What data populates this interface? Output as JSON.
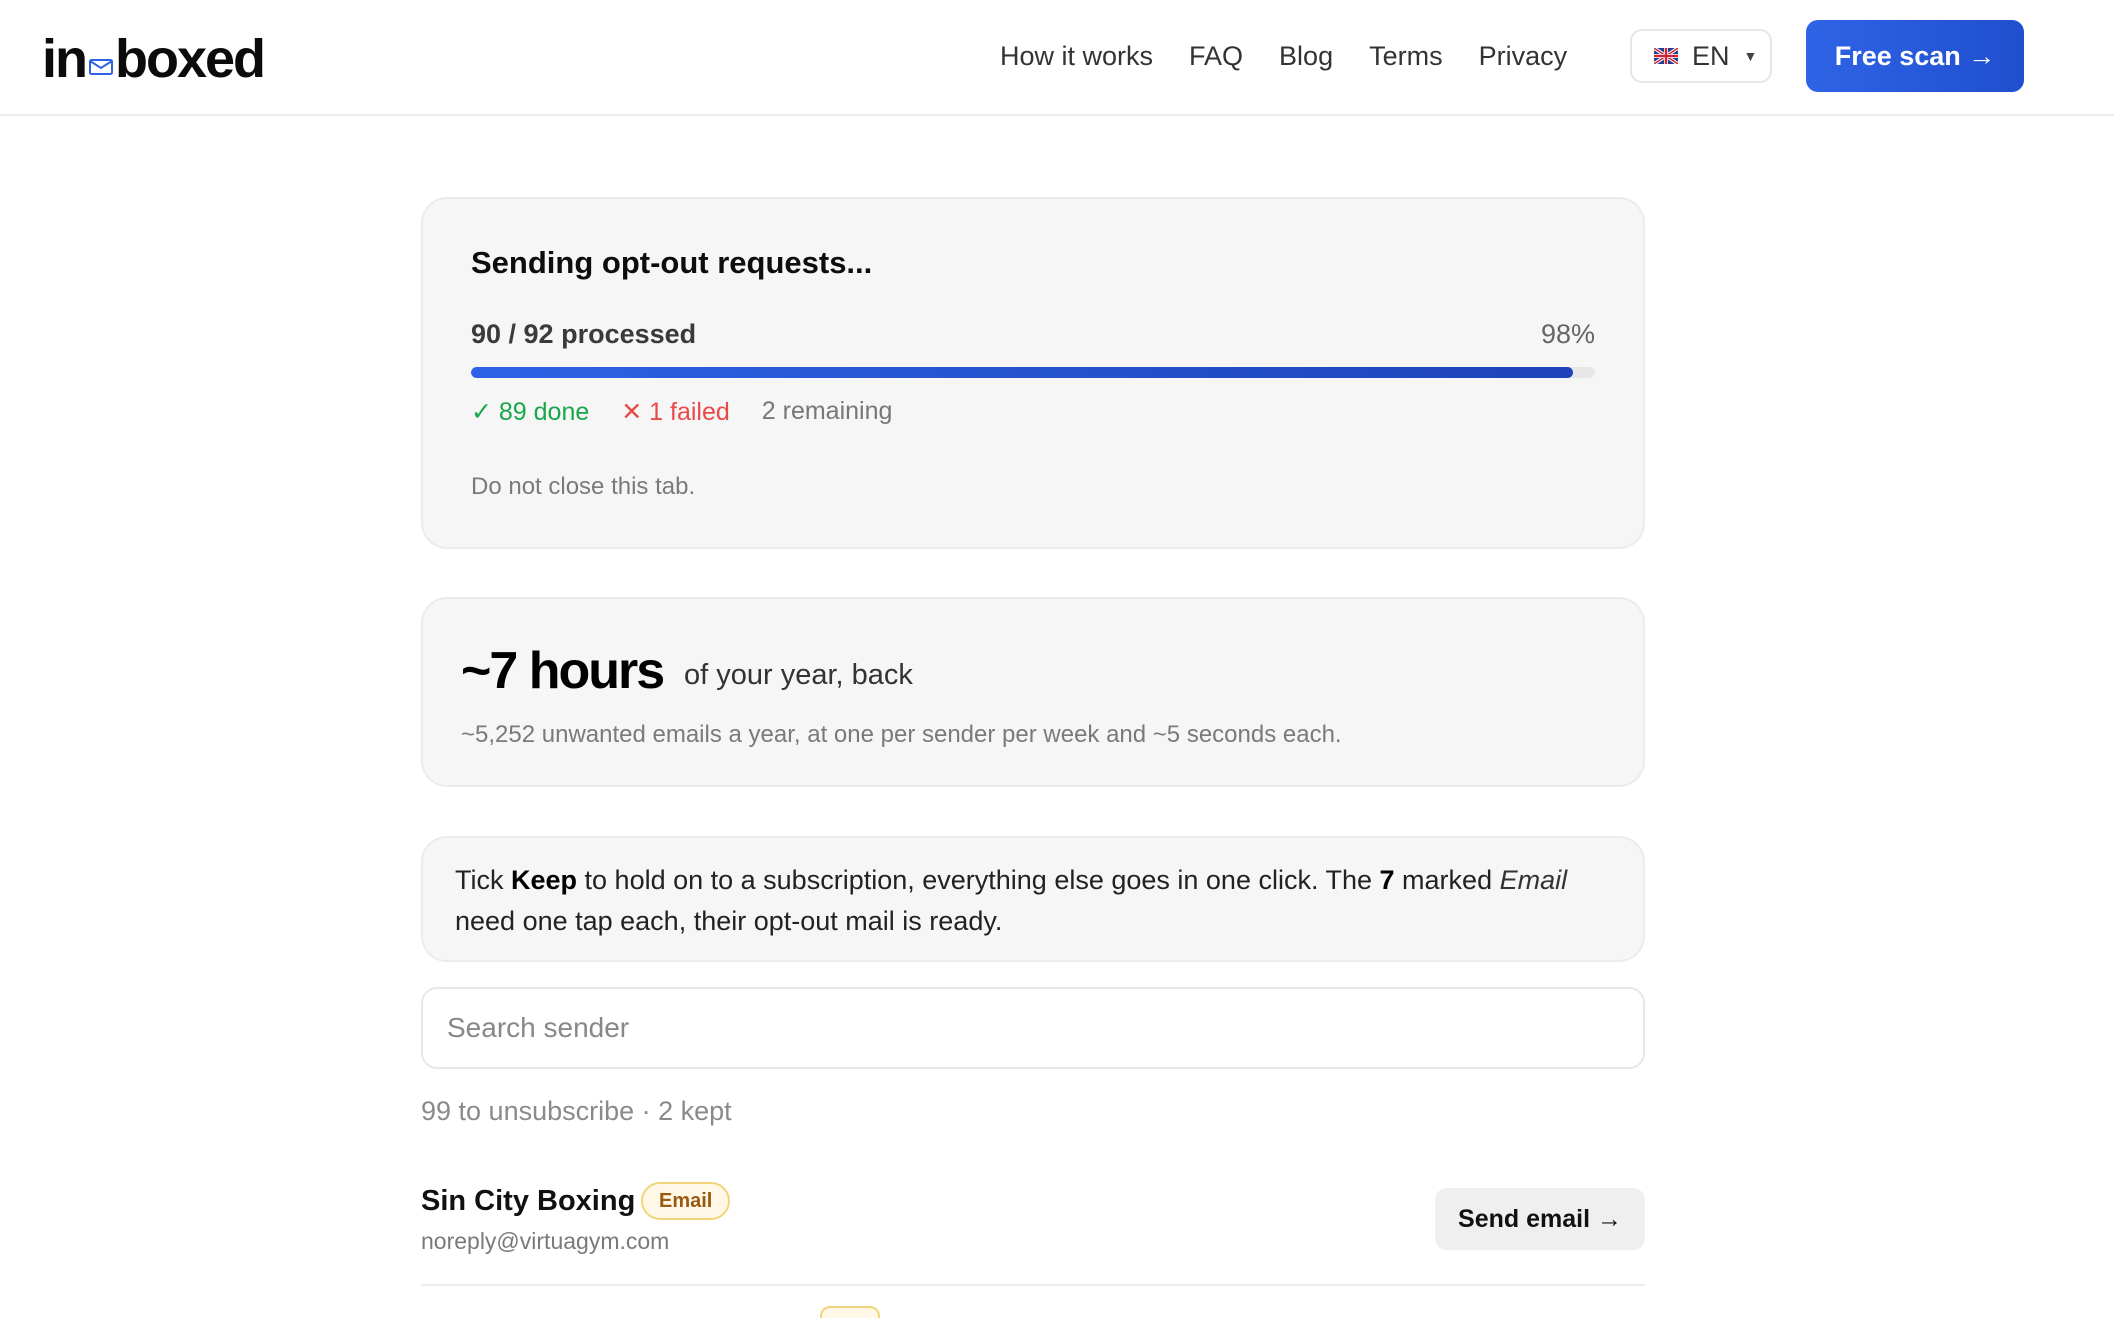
{
  "header": {
    "logo_left": "in",
    "logo_right": "boxed",
    "nav": [
      "How it works",
      "FAQ",
      "Blog",
      "Terms",
      "Privacy"
    ],
    "language": "EN",
    "cta_label": "Free scan →"
  },
  "progress": {
    "title": "Sending opt-out requests...",
    "processed_text": "90 / 92 processed",
    "percent_text": "98%",
    "percent_value": 0.98,
    "done": "✓ 89 done",
    "failed": "✕ 1 failed",
    "remaining": "2 remaining",
    "note": "Do not close this tab."
  },
  "savings": {
    "headline": "~7 hours",
    "subline": "of your year, back",
    "detail": "~5,252 unwanted emails a year, at one per sender per week and ~5 seconds each."
  },
  "info": {
    "t1": "Tick ",
    "keep": "Keep",
    "t2": " to hold on to a subscription, everything else goes in one click. The ",
    "count": "7",
    "t3": " marked ",
    "email_word": "Email",
    "t4": " need one tap each, their opt-out mail is ready."
  },
  "search": {
    "placeholder": "Search sender"
  },
  "summary": {
    "counts": "99 to unsubscribe · 2 kept"
  },
  "senders": [
    {
      "name": "Sin City Boxing",
      "badge": "Email",
      "email": "noreply@virtuagym.com",
      "action_label": "Send email →"
    }
  ],
  "colors": {
    "accent": "#2f63e6",
    "done": "#1aa64a",
    "failed": "#e84a4a",
    "badge_border": "#f2d47a"
  }
}
